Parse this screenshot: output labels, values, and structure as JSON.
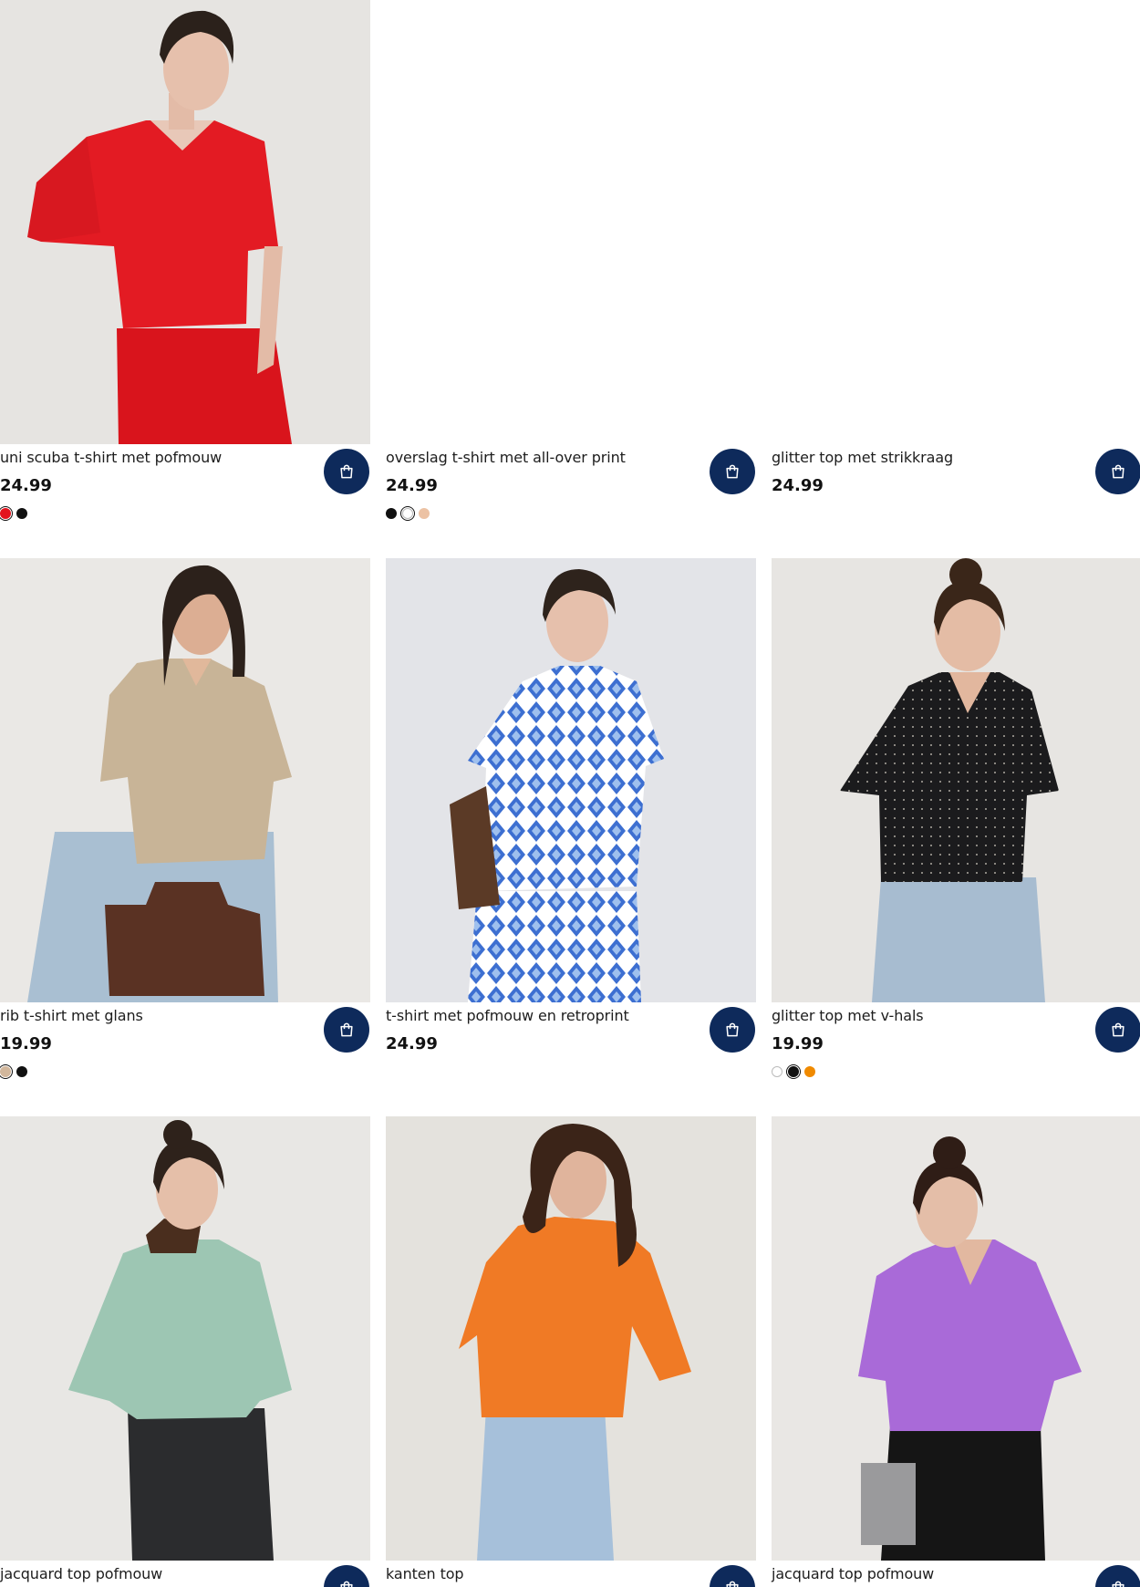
{
  "products": [
    {
      "title": "uni scuba t-shirt met pofmouw",
      "price": "24.99",
      "image": "woman-red-tshirt",
      "bg": "#e6e4e1",
      "swatches": [
        {
          "color": "#e3141e",
          "selected": true
        },
        {
          "color": "#111111",
          "selected": false
        }
      ]
    },
    {
      "title": "overslag t-shirt met all-over print",
      "price": "24.99",
      "image": "blank",
      "bg": "#ffffff",
      "swatches": [
        {
          "color": "#111111",
          "selected": false
        },
        {
          "color": "#ffffff",
          "selected": true
        },
        {
          "color": "#ecc2a4",
          "selected": false
        }
      ]
    },
    {
      "title": "glitter top met strikkraag",
      "price": "24.99",
      "image": "blank",
      "bg": "#ffffff",
      "swatches": []
    },
    {
      "title": "rib t-shirt met glans",
      "price": "19.99",
      "image": "woman-beige-tshirt",
      "bg": "#eae8e5",
      "swatches": [
        {
          "color": "#d2b79c",
          "selected": true
        },
        {
          "color": "#111111",
          "selected": false
        }
      ]
    },
    {
      "title": "t-shirt met pofmouw en retroprint",
      "price": "24.99",
      "image": "woman-blue-print-top",
      "bg": "#e3e4e8",
      "swatches": []
    },
    {
      "title": "glitter top met v-hals",
      "price": "19.99",
      "image": "woman-black-glitter-top",
      "bg": "#e7e5e2",
      "swatches": [
        {
          "color": "#ffffff",
          "selected": false
        },
        {
          "color": "#111111",
          "selected": true
        },
        {
          "color": "#f08a00",
          "selected": false
        }
      ]
    },
    {
      "title": "jacquard top pofmouw",
      "price": "",
      "image": "woman-mint-top",
      "bg": "#e8e7e4",
      "swatches": []
    },
    {
      "title": "kanten top",
      "price": "",
      "image": "woman-orange-lace-top",
      "bg": "#e4e2dd",
      "swatches": []
    },
    {
      "title": "jacquard top pofmouw",
      "price": "",
      "image": "woman-purple-top",
      "bg": "#e9e7e4",
      "swatches": []
    }
  ],
  "icons": {
    "cart": "shopping-bag-icon"
  },
  "colors": {
    "cart_button": "#0e2a5b"
  }
}
